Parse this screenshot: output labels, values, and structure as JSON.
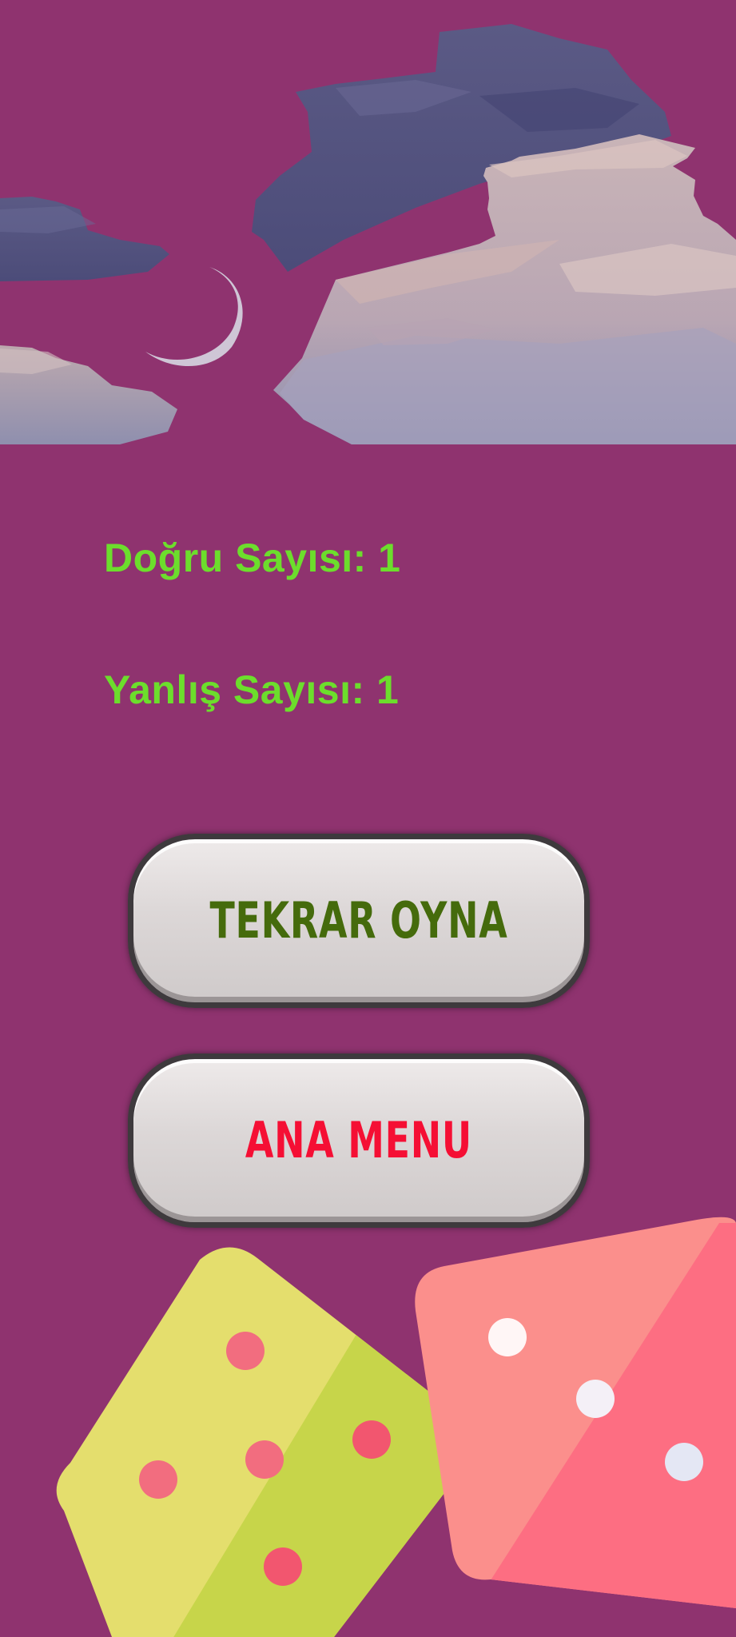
{
  "scores": {
    "correct_label": "Doğru Sayısı: 1",
    "wrong_label": "Yanlış Sayısı: 1"
  },
  "buttons": {
    "replay_label": "TEKRAR OYNA",
    "main_menu_label": "ANA MENU"
  },
  "colors": {
    "background": "#8f336f",
    "score_text": "#6cde2c",
    "replay_text": "#456b0c",
    "main_menu_text": "#f50f34",
    "button_face": "#dcd7d7"
  },
  "decorations": {
    "banner": "night-sky-clouds-with-crescent-moon",
    "dice": [
      "yellow-green-die-five",
      "pink-die-three"
    ]
  }
}
